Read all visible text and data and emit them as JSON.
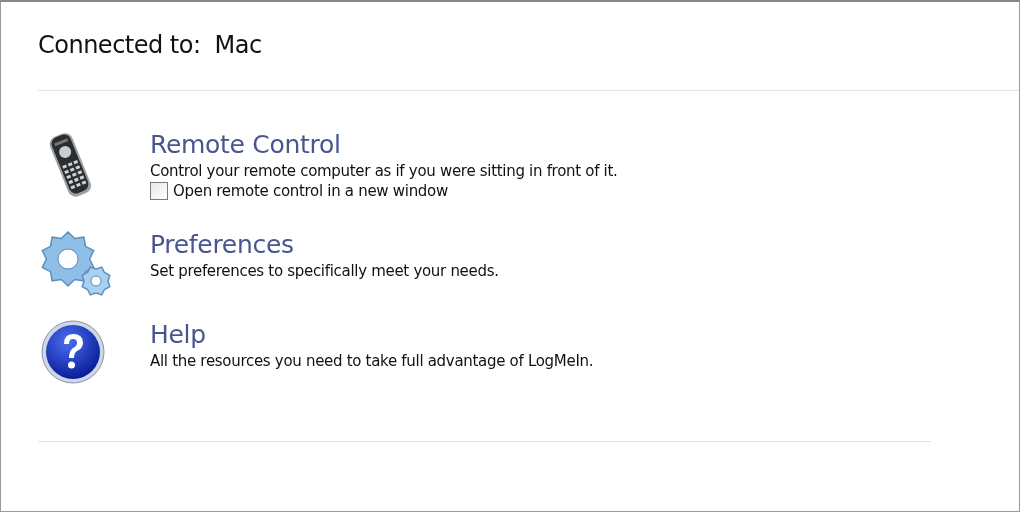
{
  "header": {
    "label": "Connected to:",
    "value": "Mac"
  },
  "items": [
    {
      "kind": "remote",
      "title": "Remote Control",
      "description": "Control your remote computer as if you were sitting in front of it.",
      "option": {
        "label": "Open remote control in a new window",
        "checked": false
      }
    },
    {
      "kind": "preferences",
      "title": "Preferences",
      "description": "Set preferences to specifically meet your needs."
    },
    {
      "kind": "help",
      "title": "Help",
      "description": "All the resources you need to take full advantage of LogMeIn."
    }
  ]
}
